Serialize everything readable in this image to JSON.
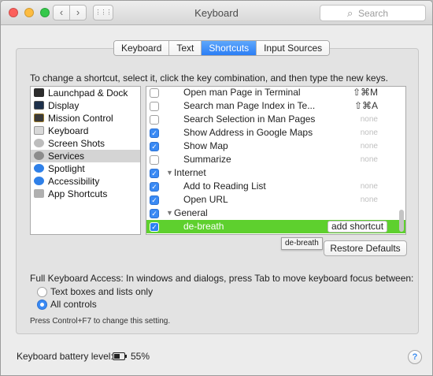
{
  "window": {
    "title": "Keyboard",
    "search_placeholder": "Search",
    "back_icon": "‹",
    "forward_icon": "›",
    "grid_icon": "⋮⋮⋮"
  },
  "tabs": [
    {
      "label": "Keyboard",
      "active": false
    },
    {
      "label": "Text",
      "active": false
    },
    {
      "label": "Shortcuts",
      "active": true
    },
    {
      "label": "Input Sources",
      "active": false
    }
  ],
  "instructions": "To change a shortcut, select it, click the key combination, and then type the new keys.",
  "categories": [
    {
      "label": "Launchpad & Dock",
      "icon": "launchpad-dock-icon"
    },
    {
      "label": "Display",
      "icon": "display-icon"
    },
    {
      "label": "Mission Control",
      "icon": "mission-control-icon"
    },
    {
      "label": "Keyboard",
      "icon": "keyboard-icon"
    },
    {
      "label": "Screen Shots",
      "icon": "screen-shots-icon"
    },
    {
      "label": "Services",
      "icon": "services-gear-icon",
      "selected": true
    },
    {
      "label": "Spotlight",
      "icon": "spotlight-icon"
    },
    {
      "label": "Accessibility",
      "icon": "accessibility-icon"
    },
    {
      "label": "App Shortcuts",
      "icon": "app-shortcuts-icon"
    }
  ],
  "shortcuts": [
    {
      "label": "Open man Page in Terminal",
      "checked": false,
      "key": "⇧⌘M"
    },
    {
      "label": "Search man Page Index in Te...",
      "checked": false,
      "key": "⇧⌘A"
    },
    {
      "label": "Search Selection in Man Pages",
      "checked": false,
      "key": "none"
    },
    {
      "label": "Show Address in Google Maps",
      "checked": true,
      "key": "none"
    },
    {
      "label": "Show Map",
      "checked": true,
      "key": "none"
    },
    {
      "label": "Summarize",
      "checked": false,
      "key": "none"
    },
    {
      "label": "Internet",
      "checked": true,
      "group": true
    },
    {
      "label": "Add to Reading List",
      "checked": true,
      "key": "none"
    },
    {
      "label": "Open URL",
      "checked": true,
      "key": "none"
    },
    {
      "label": "General",
      "checked": true,
      "group": true
    },
    {
      "label": "de-breath",
      "checked": true,
      "selected": true,
      "button": "add shortcut"
    }
  ],
  "tooltip": "de-breath",
  "restore_defaults": "Restore Defaults",
  "full_keyboard_access": {
    "label": "Full Keyboard Access: In windows and dialogs, press Tab to move keyboard focus between:",
    "options": [
      {
        "label": "Text boxes and lists only",
        "selected": false
      },
      {
        "label": "All controls",
        "selected": true
      }
    ],
    "note": "Press Control+F7 to change this setting."
  },
  "battery": {
    "label": "Keyboard battery level:",
    "percent_text": "55%",
    "level": 0.55
  },
  "help_icon": "?",
  "colors": {
    "accent": "#3a8af4",
    "selection": "#5ed02e",
    "close": "#fc605c",
    "minimize": "#fdbc40",
    "zoom": "#34c84a"
  }
}
